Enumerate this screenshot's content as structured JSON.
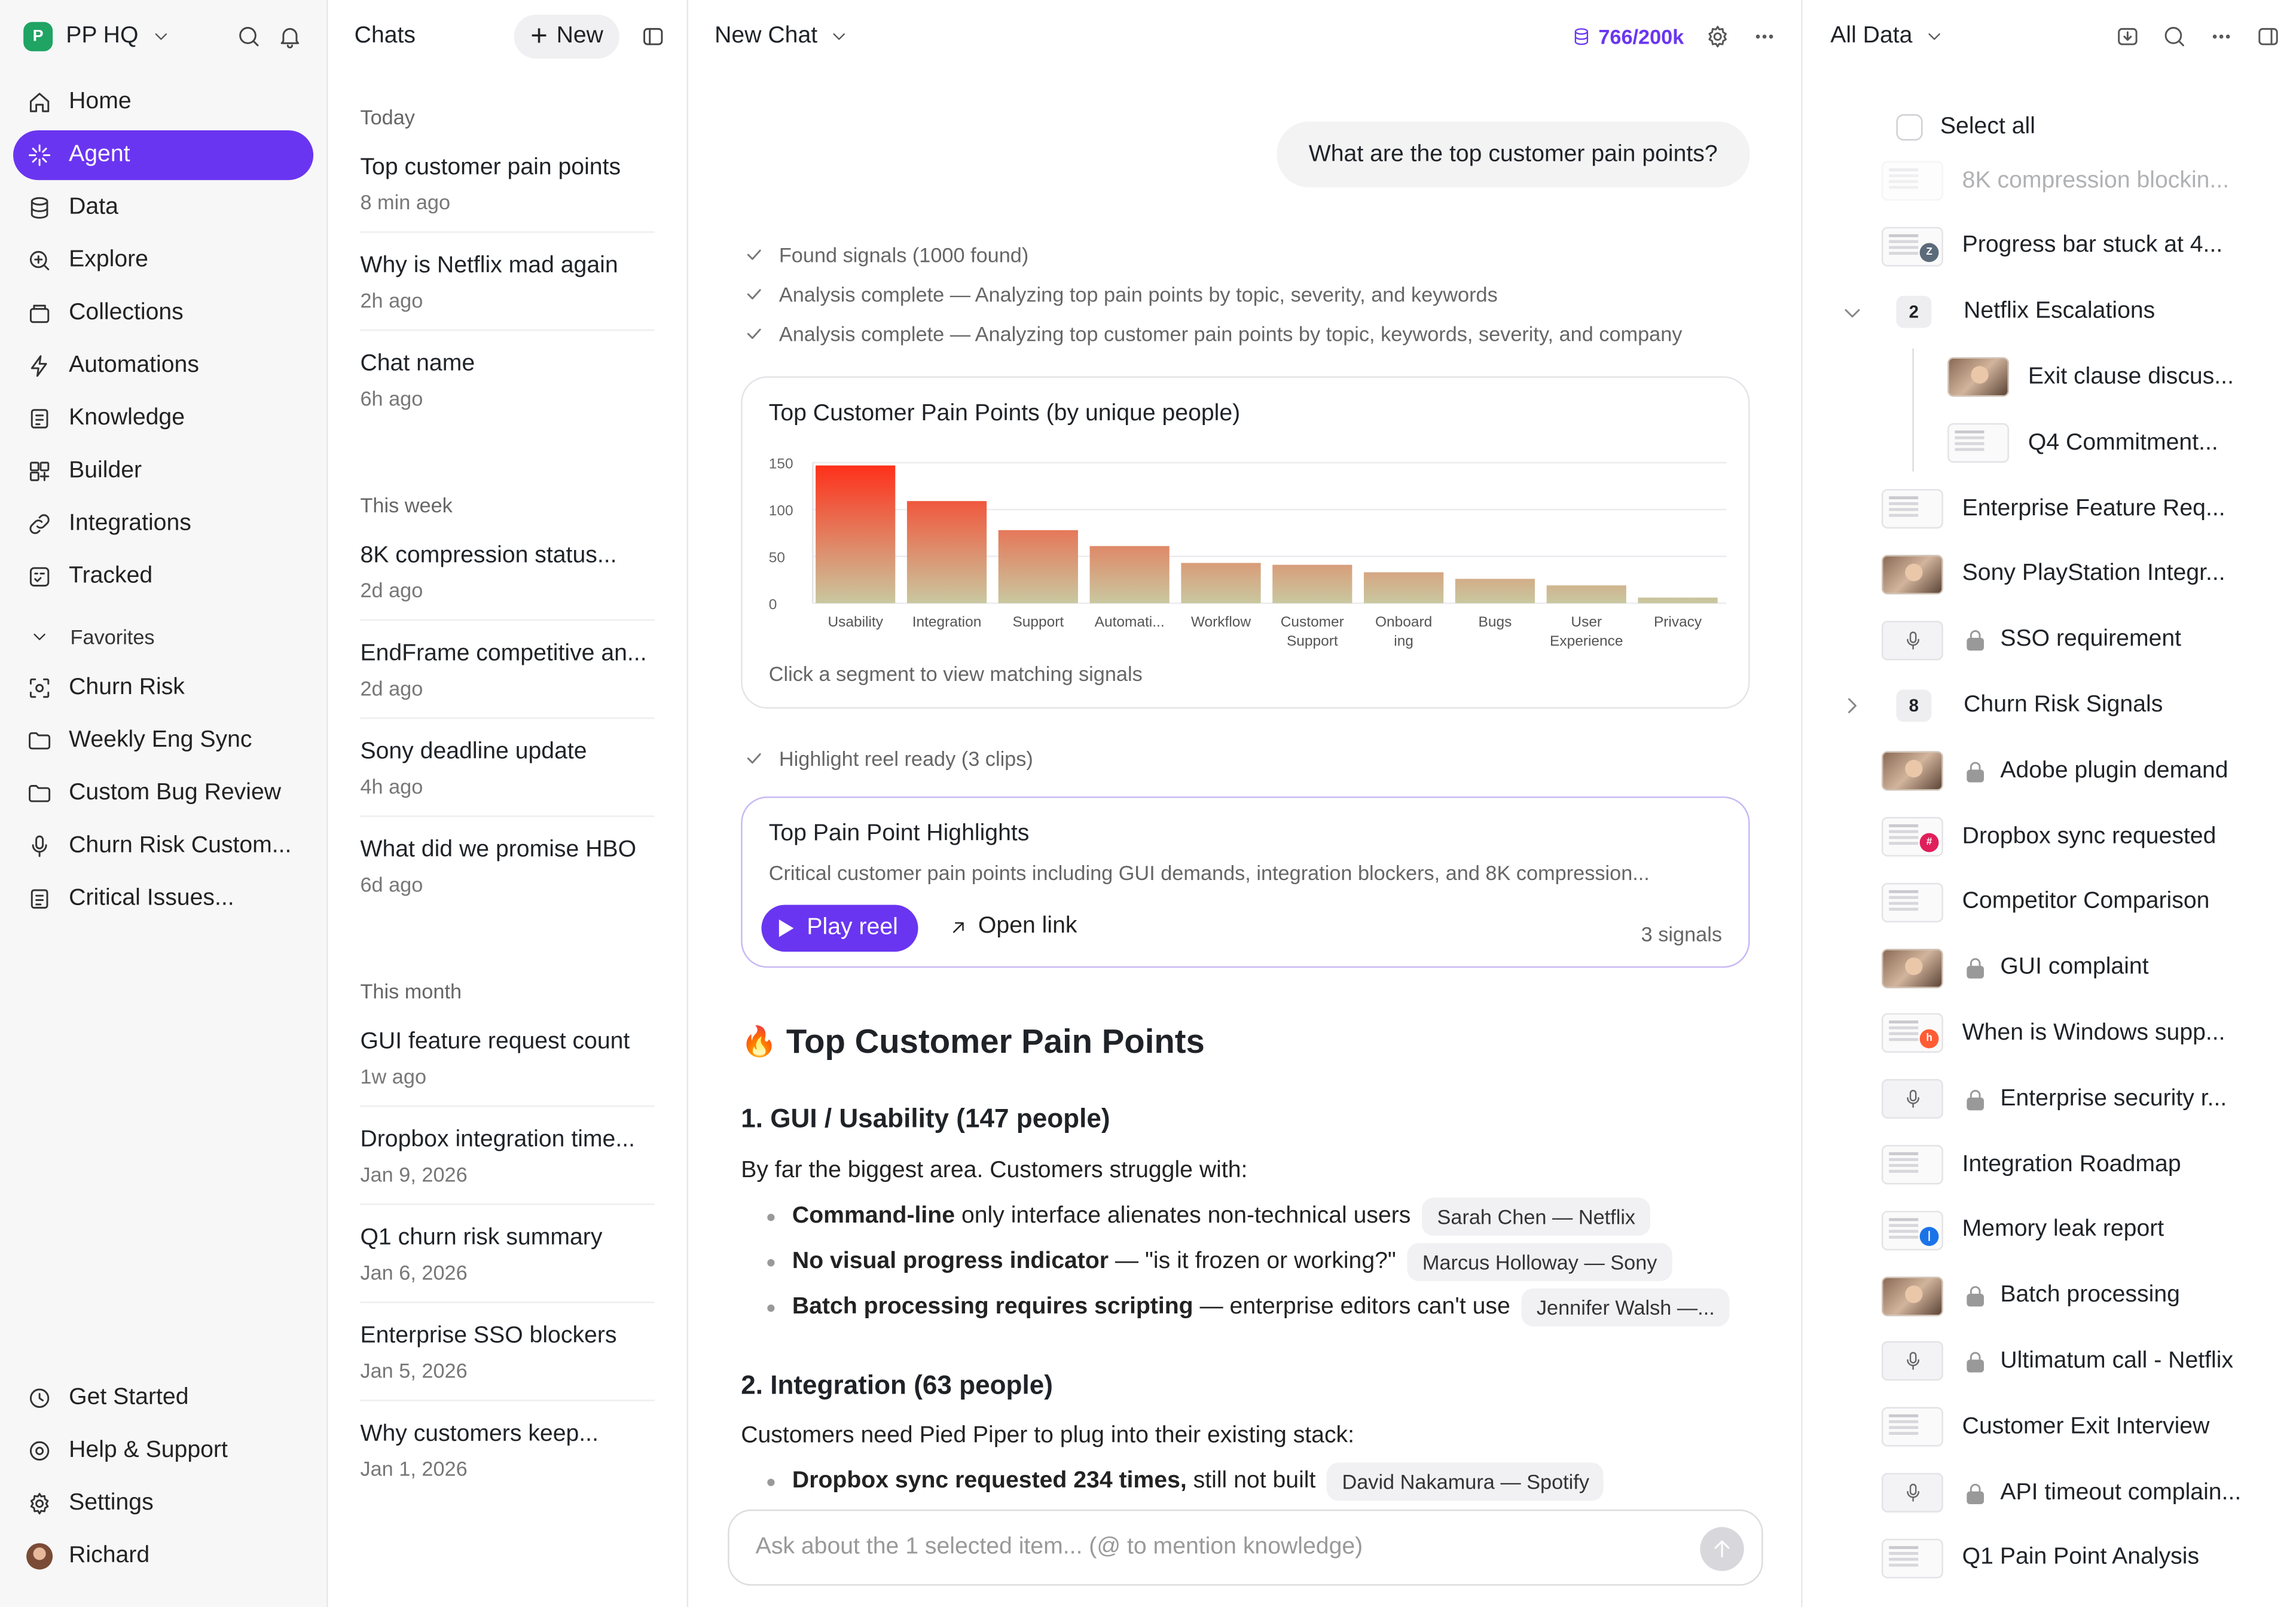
{
  "workspace": {
    "name": "PP HQ",
    "logo": "P"
  },
  "nav": {
    "items": [
      {
        "label": "Home",
        "icon": "home-icon"
      },
      {
        "label": "Agent",
        "icon": "sparkle-icon",
        "active": true
      },
      {
        "label": "Data",
        "icon": "database-icon"
      },
      {
        "label": "Explore",
        "icon": "zoom-icon"
      },
      {
        "label": "Collections",
        "icon": "collections-icon"
      },
      {
        "label": "Automations",
        "icon": "automation-icon"
      },
      {
        "label": "Knowledge",
        "icon": "knowledge-icon"
      },
      {
        "label": "Builder",
        "icon": "builder-icon"
      },
      {
        "label": "Integrations",
        "icon": "link-icon"
      },
      {
        "label": "Tracked",
        "icon": "tracked-icon"
      }
    ],
    "favorites_label": "Favorites",
    "favorites": [
      {
        "label": "Churn Risk",
        "icon": "scan-icon"
      },
      {
        "label": "Weekly Eng Sync",
        "icon": "folder-icon"
      },
      {
        "label": "Custom Bug Review",
        "icon": "folder-icon"
      },
      {
        "label": "Churn Risk Custom...",
        "icon": "mic-icon"
      },
      {
        "label": "Critical Issues...",
        "icon": "doc-icon"
      }
    ],
    "footer": [
      {
        "label": "Get Started",
        "icon": "clock-icon"
      },
      {
        "label": "Help & Support",
        "icon": "help-icon"
      },
      {
        "label": "Settings",
        "icon": "gear-icon"
      },
      {
        "label": "Richard",
        "icon": "avatar"
      }
    ]
  },
  "chats": {
    "title": "Chats",
    "new_label": "New",
    "groups": [
      {
        "label": "Today",
        "items": [
          {
            "title": "Top customer pain points",
            "time": "8 min ago"
          },
          {
            "title": "Why is Netflix mad again",
            "time": "2h ago"
          },
          {
            "title": "Chat name",
            "time": "6h ago"
          }
        ]
      },
      {
        "label": "This week",
        "items": [
          {
            "title": "8K compression status...",
            "time": "2d ago"
          },
          {
            "title": "EndFrame competitive an...",
            "time": "2d ago"
          },
          {
            "title": "Sony deadline update",
            "time": "4h ago"
          },
          {
            "title": "What did we promise HBO",
            "time": "6d ago"
          }
        ]
      },
      {
        "label": "This month",
        "items": [
          {
            "title": "GUI feature request count",
            "time": "1w ago"
          },
          {
            "title": "Dropbox integration time...",
            "time": "Jan 9, 2026"
          },
          {
            "title": "Q1 churn risk summary",
            "time": "Jan 6, 2026"
          },
          {
            "title": "Enterprise SSO blockers",
            "time": "Jan 5, 2026"
          },
          {
            "title": "Why customers keep...",
            "time": "Jan 1, 2026"
          }
        ]
      }
    ]
  },
  "main": {
    "title": "New Chat",
    "credits": "766/200k",
    "user_message": "What are the top customer pain points?",
    "steps": [
      "Found signals (1000 found)",
      "Analysis complete — Analyzing top pain points by topic, severity, and keywords",
      "Analysis complete — Analyzing top customer pain points by topic, keywords, severity, and company"
    ],
    "chart_card": {
      "title": "Top Customer Pain Points (by unique people)",
      "hint": "Click a segment to view matching signals"
    },
    "highlight_step": "Highlight reel ready (3 clips)",
    "highlights": {
      "title": "Top Pain Point Highlights",
      "description": "Critical customer pain points including GUI demands, integration blockers, and 8K compression...",
      "play_label": "Play reel",
      "open_label": "Open link",
      "signals": "3 signals"
    },
    "report": {
      "heading": "Top Customer Pain Points",
      "heading_icon": "🔥",
      "s1_title": "1. GUI / Usability (147 people)",
      "s1_intro": "By far the biggest area. Customers struggle with:",
      "s1_bullets": [
        {
          "bold": "Command-line",
          "rest": " only interface alienates non-technical users",
          "chip": "Sarah Chen — Netflix"
        },
        {
          "bold": "No visual progress indicator",
          "rest": " — \"is it frozen or working?\"",
          "chip": "Marcus Holloway — Sony"
        },
        {
          "bold": "Batch processing requires scripting",
          "rest": " — enterprise editors can't use",
          "chip": "Jennifer Walsh —..."
        }
      ],
      "s2_title": "2. Integration (63 people)",
      "s2_intro": "Customers need Pied Piper to plug into their existing stack:",
      "s2_bullets": [
        {
          "bold": "Dropbox sync requested 234 times,",
          "rest": " still not built",
          "chip": "David Nakamura — Spotify"
        }
      ]
    },
    "composer_placeholder": "Ask about the 1 selected item... (@ to mention knowledge)"
  },
  "data_panel": {
    "title": "All Data",
    "select_all": "Select all",
    "rows": [
      {
        "label": "8K compression blockin...",
        "thumb": "doc",
        "faded": true
      },
      {
        "label": "Progress bar stuck at 4...",
        "thumb": "doc",
        "badge": "Z",
        "badge_color": "#5b6b7a"
      },
      {
        "label": "Netflix Escalations",
        "group": true,
        "count": "2",
        "expanded": true
      },
      {
        "label": "Exit clause discus...",
        "thumb": "vid",
        "child": true
      },
      {
        "label": "Q4 Commitment...",
        "thumb": "doc",
        "child": true
      },
      {
        "label": "Enterprise Feature Req...",
        "thumb": "doc"
      },
      {
        "label": "Sony PlayStation Integr...",
        "thumb": "vid"
      },
      {
        "label": "SSO requirement",
        "thumb": "mic",
        "locked": true
      },
      {
        "label": "Churn Risk Signals",
        "group": true,
        "count": "8",
        "expanded": false
      },
      {
        "label": "Adobe plugin demand",
        "thumb": "vid",
        "locked": true
      },
      {
        "label": "Dropbox sync requested",
        "thumb": "doc",
        "badge": "#",
        "badge_color": "#e01e5a"
      },
      {
        "label": "Competitor Comparison",
        "thumb": "doc"
      },
      {
        "label": "GUI complaint",
        "thumb": "vid",
        "locked": true
      },
      {
        "label": "When is Windows supp...",
        "thumb": "doc",
        "badge": "h",
        "badge_color": "#ff5c35"
      },
      {
        "label": "Enterprise security r...",
        "thumb": "mic",
        "locked": true
      },
      {
        "label": "Integration Roadmap",
        "thumb": "doc"
      },
      {
        "label": "Memory leak report",
        "thumb": "doc",
        "badge": "|",
        "badge_color": "#1a73e8"
      },
      {
        "label": "Batch processing",
        "thumb": "vid",
        "locked": true
      },
      {
        "label": "Ultimatum call - Netflix",
        "thumb": "mic",
        "locked": true
      },
      {
        "label": "Customer Exit Interview",
        "thumb": "doc"
      },
      {
        "label": "API timeout complain...",
        "thumb": "mic",
        "locked": true
      },
      {
        "label": "Q1 Pain Point Analysis",
        "thumb": "doc"
      }
    ]
  },
  "chart_data": {
    "type": "bar",
    "title": "Top Customer Pain Points (by unique people)",
    "categories": [
      "Usability",
      "Integration",
      "Support",
      "Automati...",
      "Workflow",
      "Customer Support",
      "Onboarding",
      "Bugs",
      "User Experience",
      "Privacy"
    ],
    "category_lines": [
      [
        "Usability"
      ],
      [
        "Integration"
      ],
      [
        "Support"
      ],
      [
        "Automati..."
      ],
      [
        "Workflow"
      ],
      [
        "Customer",
        "Support"
      ],
      [
        "Onboard",
        "ing"
      ],
      [
        "Bugs"
      ],
      [
        "User",
        "Experience"
      ],
      [
        "Privacy"
      ]
    ],
    "values": [
      147,
      109,
      78,
      61,
      43,
      41,
      33,
      26,
      19,
      6
    ],
    "yticks": [
      0,
      50,
      100,
      150
    ],
    "ylim": [
      0,
      150
    ],
    "grid": true,
    "top_color": "#ff2d17",
    "bottom_color": "#c9c8a0",
    "xlabel": "",
    "ylabel": ""
  }
}
